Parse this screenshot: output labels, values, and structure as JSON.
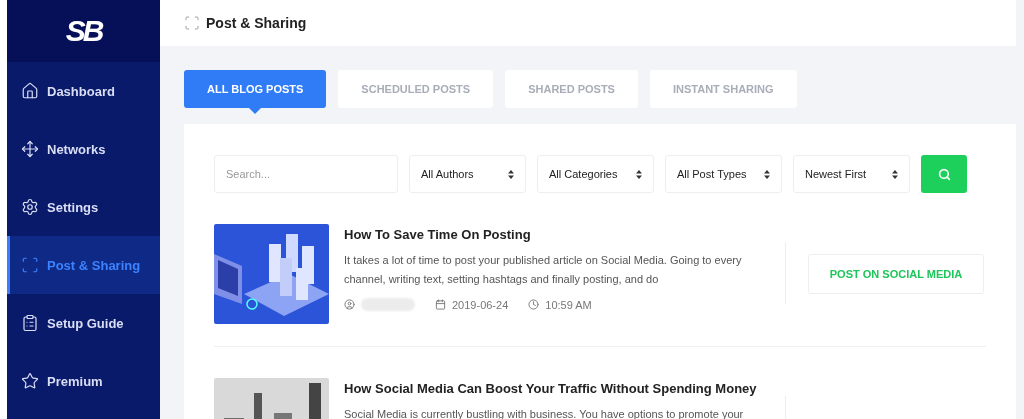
{
  "logo": {
    "text": "SB"
  },
  "sidebar": {
    "items": [
      {
        "label": "Dashboard",
        "selected": false
      },
      {
        "label": "Networks",
        "selected": false
      },
      {
        "label": "Settings",
        "selected": false
      },
      {
        "label": "Post & Sharing",
        "selected": true
      },
      {
        "label": "Setup Guide",
        "selected": false
      },
      {
        "label": "Premium",
        "selected": false
      }
    ]
  },
  "header": {
    "title": "Post & Sharing"
  },
  "tabs": [
    {
      "label": "ALL BLOG POSTS",
      "selected": true
    },
    {
      "label": "SCHEDULED POSTS",
      "selected": false
    },
    {
      "label": "SHARED POSTS",
      "selected": false
    },
    {
      "label": "INSTANT SHARING",
      "selected": false
    }
  ],
  "filters": {
    "search": {
      "placeholder": "Search..."
    },
    "selects": [
      "All Authors",
      "All Categories",
      "All Post Types",
      "Newest First"
    ]
  },
  "posts": [
    {
      "title": "How To Save Time On Posting",
      "excerpt": "It takes a lot of time to post your published article on Social Media. Going to every channel, writing text, setting hashtags and finally posting, and do",
      "date": "2019-06-24",
      "time": "10:59 AM",
      "action": "POST ON SOCIAL MEDIA"
    },
    {
      "title": "How Social Media Can Boost Your Traffic Without Spending Money",
      "excerpt": "Social Media is currently bustling with business. You have options to promote your"
    }
  ]
}
